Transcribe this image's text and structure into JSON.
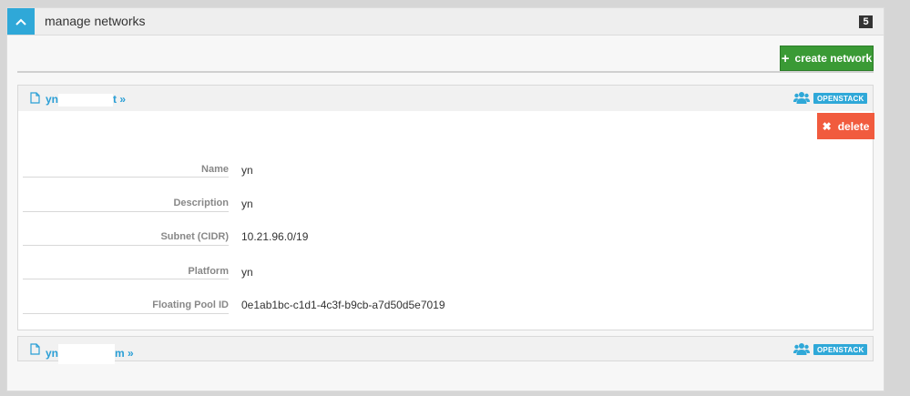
{
  "panel": {
    "title": "manage networks",
    "count": "5",
    "create_button_label": "create network"
  },
  "networks": [
    {
      "link_prefix": "yn",
      "link_suffix": "t »",
      "platform_badge": "OPENSTACK",
      "delete_label": "delete",
      "details": [
        {
          "label": "Name",
          "value": "yn"
        },
        {
          "label": "Description",
          "value": "yn"
        },
        {
          "label": "Subnet (CIDR)",
          "value": "10.21.96.0/19"
        },
        {
          "label": "Platform",
          "value": "yn"
        },
        {
          "label": "Floating Pool ID",
          "value": "0e1ab1bc-c1d1-4c3f-b9cb-a7d50d5e7019"
        }
      ]
    },
    {
      "link_prefix": "yn",
      "link_suffix": "m »",
      "platform_badge": "OPENSTACK"
    }
  ],
  "icons": {
    "collapse": "chevron-up-icon",
    "create": "plus-icon",
    "file": "file-icon",
    "users": "users-icon",
    "delete": "close-icon"
  },
  "colors": {
    "accent": "#2fa8d8",
    "create_button": "#3a9a35",
    "delete_button": "#f15b3e",
    "link": "#2a9fd6"
  }
}
